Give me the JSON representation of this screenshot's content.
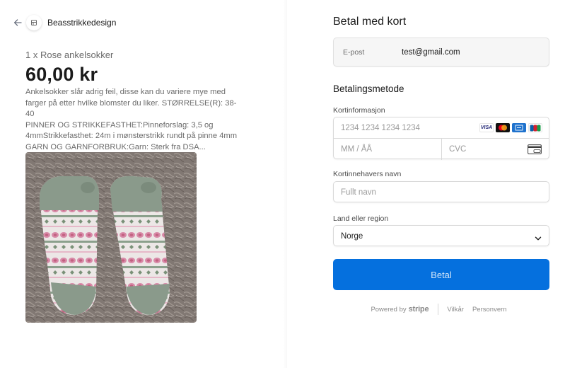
{
  "merchant": {
    "name": "Beasstrikkedesign",
    "back_icon": "arrow-left-icon",
    "logo_icon": "store-icon"
  },
  "product": {
    "qty_name": "1 x Rose ankelsokker",
    "price": "60,00 kr",
    "description_lines": [
      "Ankelsokker slår adrig feil, disse kan du variere mye med",
      "farger på etter hvilke blomster du liker. STØRRELSE(R): 38-40",
      "PINNER OG STRIKKEFASTHET:Pinneforslag: 3,5 og",
      "4mmStrikkefasthet: 24m i mønsterstrikk rundt på pinne 4mm",
      "GARN OG GARNFORBRUK:Garn: Sterk fra DSA..."
    ]
  },
  "checkout": {
    "title": "Betal med kort",
    "email": {
      "label": "E-post",
      "value": "test@gmail.com"
    },
    "payment_method_title": "Betalingsmetode",
    "card_info_label": "Kortinformasjon",
    "card_number_placeholder": "1234 1234 1234 1234",
    "expiry_placeholder": "MM / ÅÅ",
    "cvc_placeholder": "CVC",
    "card_brands": [
      "VISA",
      "mastercard",
      "amex",
      "jcb"
    ],
    "cardholder_label": "Kortinnehavers navn",
    "cardholder_placeholder": "Fullt navn",
    "country_label": "Land eller region",
    "country_value": "Norge",
    "pay_button": "Betal"
  },
  "footer": {
    "powered_by": "Powered by",
    "brand": "stripe",
    "terms": "Vilkår",
    "privacy": "Personvern"
  },
  "colors": {
    "accent": "#0570de",
    "muted_text": "#6b6b6b",
    "border": "#d9d9d9",
    "email_bg": "#f6f6f6"
  }
}
